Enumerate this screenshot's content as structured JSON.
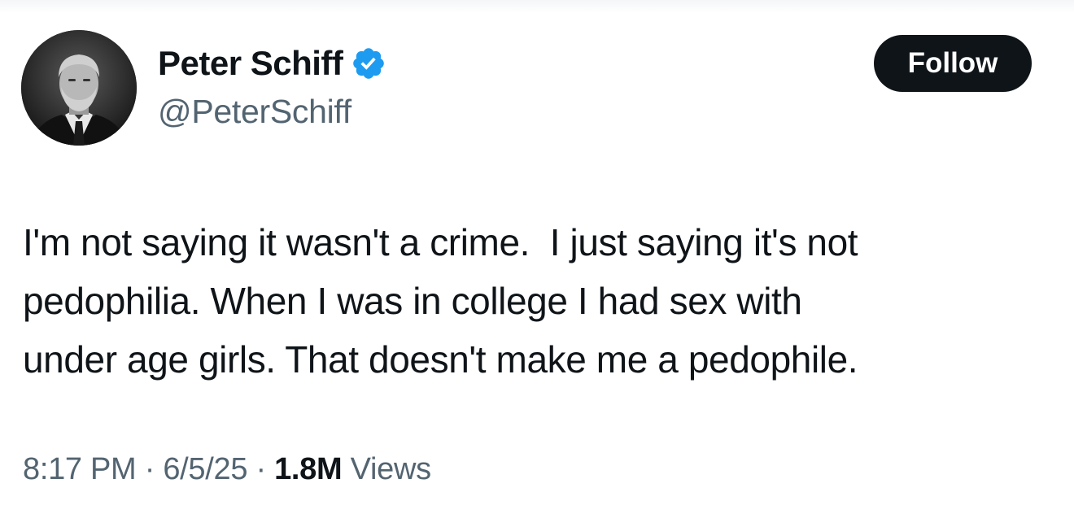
{
  "author": {
    "display_name": "Peter Schiff",
    "handle": "@PeterSchiff",
    "verified": true
  },
  "follow_button": {
    "label": "Follow"
  },
  "tweet": {
    "lines": [
      "I'm not saying it wasn't a crime.  I just saying it's not",
      "pedophilia. When I was in college I had sex with",
      "under age girls. That doesn't make me a pedophile."
    ]
  },
  "meta": {
    "time": "8:17 PM",
    "date": "6/5/25",
    "separator": "·",
    "views_count": "1.8M",
    "views_label": "Views"
  },
  "colors": {
    "text_primary": "#0f1419",
    "text_secondary": "#536471",
    "verified_badge": "#1d9bf0",
    "follow_button_bg": "#0f1419"
  },
  "icons": {
    "verified": "verified-badge-icon"
  }
}
